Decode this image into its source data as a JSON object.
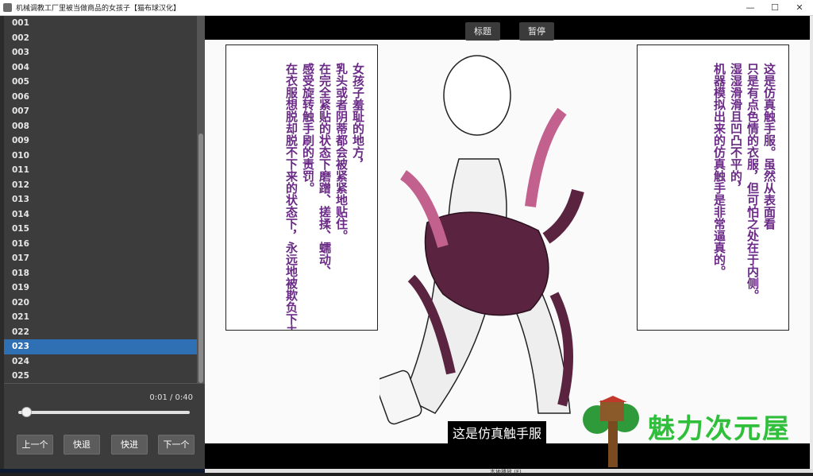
{
  "window": {
    "title": "机械调教工厂里被当做商品的女孩子【猫布球汉化】",
    "minimize_glyph": "—",
    "maximize_glyph": "☐",
    "close_glyph": "✕"
  },
  "episodes": [
    "001",
    "002",
    "003",
    "004",
    "005",
    "006",
    "007",
    "008",
    "009",
    "010",
    "011",
    "012",
    "013",
    "014",
    "015",
    "016",
    "017",
    "018",
    "019",
    "020",
    "021",
    "022",
    "023",
    "024",
    "025"
  ],
  "selected_episode": "023",
  "player": {
    "time": "0:01 / 0:40",
    "progress": 0.025,
    "prev_label": "上一个",
    "rewind_label": "快退",
    "forward_label": "快进",
    "next_label": "下一个"
  },
  "video": {
    "title_button": "标题",
    "pause_button": "暂停",
    "left_panel_lines": [
      "女孩子羞耻的地方，",
      "乳头或者阴蒂都会被紧紧地贴住。",
      "在完全紧贴的状态下磨蹭、搓揉、蠕动、",
      "感受旋转触手刷的责罚。",
      "在衣服想脱却脱不下来的状态下，永远地被欺负下去。"
    ],
    "right_panel_lines": [
      "这是仿真触手服。虽然从表面看",
      "只是有点色情的衣服，但可怕之处在于内侧。",
      "湿湿滑滑且凹凸不平的，",
      "机器模拟出来的仿真触手是非常逼真的。"
    ],
    "subtitle": "这是仿真触手服",
    "watermark": "魅力次元屋",
    "colors": {
      "panel_text": "#6a2a86",
      "watermark": "#2fbf3a",
      "tentacle": "#5a2440",
      "tentacle_highlight": "#c2608e"
    }
  },
  "taskbar_snippet": "本地播放 (F)"
}
